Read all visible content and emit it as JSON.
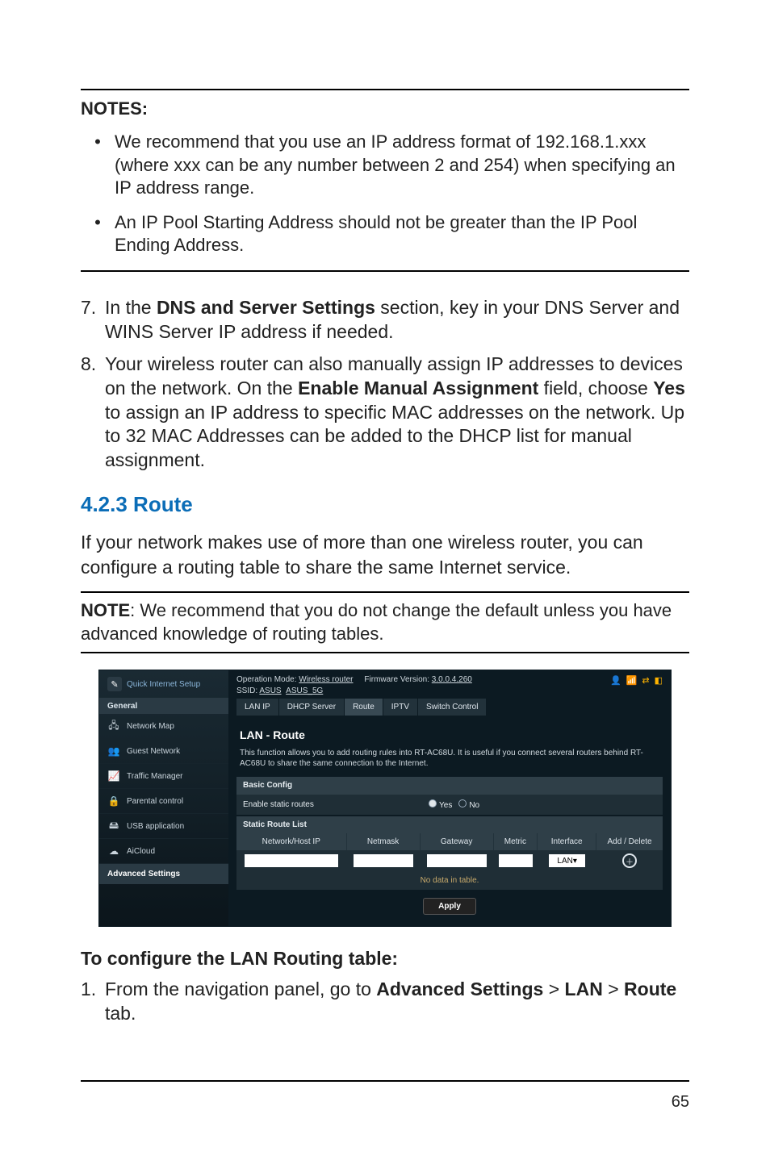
{
  "notes": {
    "title": "NOTES:",
    "items": [
      "We recommend that you use an IP address format of 192.168.1.xxx (where xxx can be any number between 2 and 254) when specifying an IP address range.",
      "An IP Pool Starting Address should not be greater than the IP Pool Ending Address."
    ]
  },
  "steps_a": {
    "n7": "7.",
    "t7a": "In the ",
    "t7b": "DNS and Server Settings",
    "t7c": " section, key in your DNS Server and WINS Server IP address if needed.",
    "n8": "8.",
    "t8a": "Your wireless router can also manually assign IP addresses to devices on the network. On the ",
    "t8b": "Enable Manual Assignment",
    "t8c": " field, choose ",
    "t8d": "Yes",
    "t8e": " to assign an IP address to specific MAC addresses on the network. Up to 32 MAC Addresses can be added to the DHCP list for manual assignment."
  },
  "section_heading": "4.2.3 Route",
  "para1": "If your network makes use of more than one wireless router, you can configure a routing table to share the same Internet service.",
  "note_single": {
    "label": "NOTE",
    "text": ":  We recommend that you do not change the default unless you have advanced knowledge of routing tables."
  },
  "router": {
    "qis": "Quick Internet Setup",
    "group_general": "General",
    "sidebar": [
      "Network Map",
      "Guest Network",
      "Traffic Manager",
      "Parental control",
      "USB application",
      "AiCloud"
    ],
    "sidebar_icons": [
      "network-map-icon",
      "guest-network-icon",
      "traffic-manager-icon",
      "parental-control-icon",
      "usb-application-icon",
      "aicloud-icon"
    ],
    "advanced": "Advanced Settings",
    "opmode_label": "Operation Mode: ",
    "opmode_value": "Wireless router",
    "fw_label": "Firmware Version: ",
    "fw_value": "3.0.0.4.260",
    "ssid_label": "SSID: ",
    "ssid1": "ASUS",
    "ssid2": "ASUS_5G",
    "tabs": [
      "LAN IP",
      "DHCP Server",
      "Route",
      "IPTV",
      "Switch Control"
    ],
    "panel_title": "LAN - Route",
    "panel_desc": "This function allows you to add routing rules into RT-AC68U. It is useful if you connect several routers behind RT-AC68U to share the same connection to the Internet.",
    "basic_config": "Basic Config",
    "enable_label": "Enable static routes",
    "yes": "Yes",
    "no": "No",
    "static_list": "Static Route List",
    "cols": [
      "Network/Host IP",
      "Netmask",
      "Gateway",
      "Metric",
      "Interface",
      "Add / Delete"
    ],
    "iface_value": "LAN",
    "nodata": "No data in table.",
    "apply": "Apply"
  },
  "subheading": "To configure the LAN Routing table:",
  "steps_b": {
    "n1": "1.",
    "t1a": "From the navigation panel, go to ",
    "t1b": "Advanced Settings",
    "gt1": " > ",
    "t1c": "LAN",
    "gt2": " > ",
    "t1d": "Route",
    "t1e": " tab."
  },
  "page_number": "65"
}
